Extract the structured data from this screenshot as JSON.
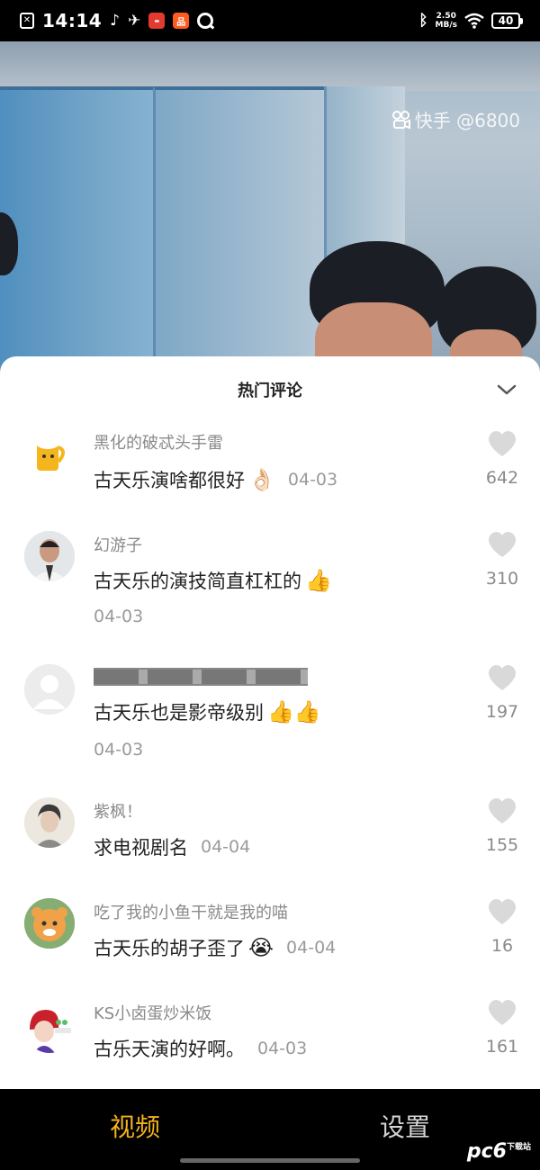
{
  "status_bar": {
    "time": "14:14",
    "net_speed_value": "2.50",
    "net_speed_unit": "MB/s",
    "battery": "40"
  },
  "video": {
    "watermark": "快手 @6800"
  },
  "comments_panel": {
    "title": "热门评论",
    "comments": [
      {
        "user": "黑化的破忒头手雷",
        "text": "古天乐演啥都很好",
        "emoji": "👌🏻",
        "date": "04-03",
        "likes": "642"
      },
      {
        "user": "幻游子",
        "text": "古天乐的演技简直杠杠的",
        "emoji": "👍",
        "date": "04-03",
        "likes": "310"
      },
      {
        "user": "",
        "text": "古天乐也是影帝级别",
        "emoji": "👍👍",
        "date": "04-03",
        "likes": "197"
      },
      {
        "user": "紫枫！",
        "text": "求电视剧名",
        "emoji": "",
        "date": "04-04",
        "likes": "155"
      },
      {
        "user": "吃了我的小鱼干就是我的喵",
        "text": "古天乐的胡子歪了",
        "emoji": "😭",
        "date": "04-04",
        "likes": "16"
      },
      {
        "user": "KS小卤蛋炒米饭",
        "text": "古乐天演的好啊。",
        "emoji": "",
        "date": "04-03",
        "likes": "161"
      }
    ]
  },
  "bottom_nav": {
    "tab_video": "视频",
    "tab_settings": "设置"
  },
  "site_logo": "pc6",
  "site_logo_sub": "下载站",
  "colors": {
    "active_tab": "#f3b21d",
    "like_icon": "#d9d9d9"
  }
}
